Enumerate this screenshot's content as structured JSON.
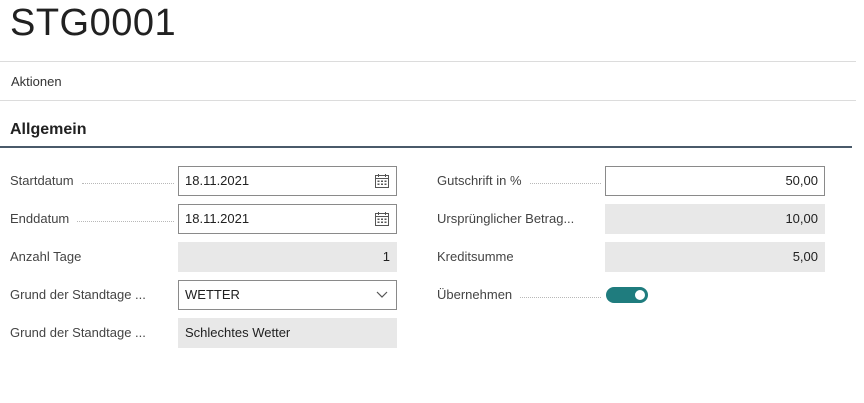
{
  "page": {
    "title": "STG0001"
  },
  "actions": {
    "label": "Aktionen"
  },
  "section": {
    "title": "Allgemein"
  },
  "left_fields": [
    {
      "label": "Startdatum",
      "value": "18.11.2021",
      "kind": "date"
    },
    {
      "label": "Enddatum",
      "value": "18.11.2021",
      "kind": "date"
    },
    {
      "label": "Anzahl Tage",
      "value": "1",
      "kind": "readonly-number"
    },
    {
      "label": "Grund der Standtage ...",
      "value": "WETTER",
      "kind": "select"
    },
    {
      "label": "Grund der Standtage ...",
      "value": "Schlechtes Wetter",
      "kind": "readonly-text"
    }
  ],
  "right_fields": [
    {
      "label": "Gutschrift in %",
      "value": "50,00",
      "kind": "number-input"
    },
    {
      "label": "Ursprünglicher Betrag...",
      "value": "10,00",
      "kind": "readonly-number"
    },
    {
      "label": "Kreditsumme",
      "value": "5,00",
      "kind": "readonly-number"
    },
    {
      "label": "Übernehmen",
      "value": true,
      "kind": "toggle"
    }
  ],
  "colors": {
    "toggle_on": "#1f7c7e",
    "section_underline": "#4a5a6a",
    "readonly_bg": "#e8e8e8"
  },
  "icons": {
    "date": "calendar-icon",
    "select": "chevron-down-icon"
  }
}
